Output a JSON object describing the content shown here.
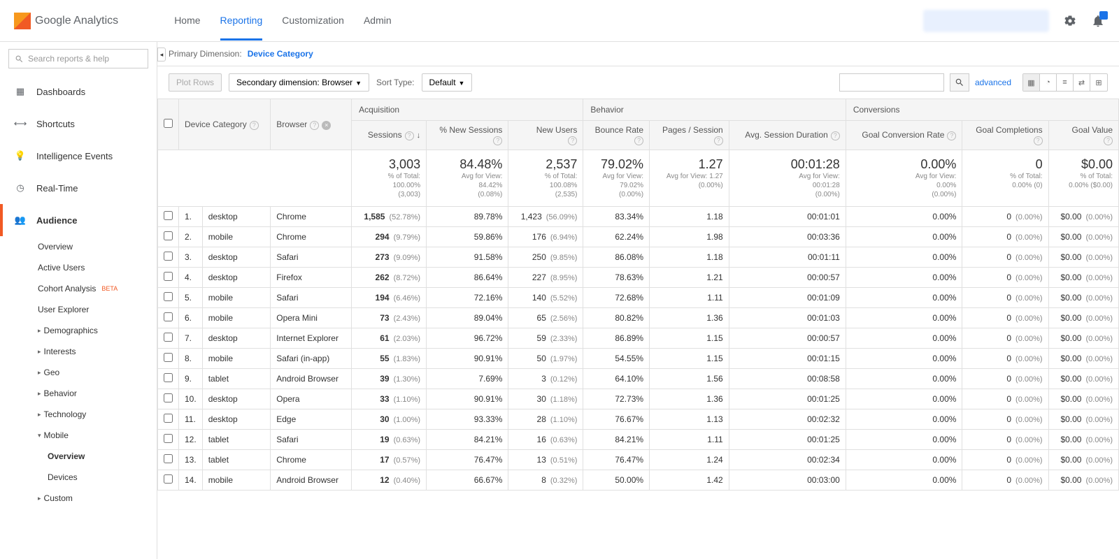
{
  "brand": {
    "name": "Google",
    "product": "Analytics"
  },
  "topnav": [
    {
      "label": "Home",
      "active": false
    },
    {
      "label": "Reporting",
      "active": true
    },
    {
      "label": "Customization",
      "active": false
    },
    {
      "label": "Admin",
      "active": false
    }
  ],
  "search_placeholder": "Search reports & help",
  "sidebar": [
    {
      "icon": "dashboard",
      "label": "Dashboards"
    },
    {
      "icon": "shortcut",
      "label": "Shortcuts"
    },
    {
      "icon": "bulb",
      "label": "Intelligence Events"
    },
    {
      "icon": "clock",
      "label": "Real-Time"
    },
    {
      "icon": "audience",
      "label": "Audience",
      "active": true,
      "children": [
        {
          "label": "Overview"
        },
        {
          "label": "Active Users"
        },
        {
          "label": "Cohort Analysis",
          "beta": "BETA"
        },
        {
          "label": "User Explorer"
        },
        {
          "label": "Demographics",
          "caret": "right"
        },
        {
          "label": "Interests",
          "caret": "right"
        },
        {
          "label": "Geo",
          "caret": "right"
        },
        {
          "label": "Behavior",
          "caret": "right"
        },
        {
          "label": "Technology",
          "caret": "right"
        },
        {
          "label": "Mobile",
          "caret": "down",
          "children": [
            {
              "label": "Overview",
              "bold": true
            },
            {
              "label": "Devices"
            }
          ]
        },
        {
          "label": "Custom",
          "caret": "right"
        }
      ]
    }
  ],
  "primary_dim_label": "Primary Dimension:",
  "primary_dim_value": "Device Category",
  "plot_rows": "Plot Rows",
  "secondary_dim": "Secondary dimension: Browser",
  "sort_type_label": "Sort Type:",
  "sort_type_value": "Default",
  "advanced": "advanced",
  "groups": {
    "acq": "Acquisition",
    "beh": "Behavior",
    "conv": "Conversions"
  },
  "headers": {
    "device": "Device Category",
    "browser": "Browser",
    "sessions": "Sessions",
    "pct_new": "% New Sessions",
    "new_users": "New Users",
    "bounce": "Bounce Rate",
    "pps": "Pages / Session",
    "avg_dur": "Avg. Session Duration",
    "gcr": "Goal Conversion Rate",
    "gc": "Goal Completions",
    "gv": "Goal Value"
  },
  "summary": {
    "sessions": {
      "big": "3,003",
      "l1": "% of Total:",
      "l2": "100.00%",
      "l3": "(3,003)"
    },
    "pct_new": {
      "big": "84.48%",
      "l1": "Avg for View:",
      "l2": "84.42%",
      "l3": "(0.08%)"
    },
    "new_users": {
      "big": "2,537",
      "l1": "% of Total:",
      "l2": "100.08%",
      "l3": "(2,535)"
    },
    "bounce": {
      "big": "79.02%",
      "l1": "Avg for View:",
      "l2": "79.02%",
      "l3": "(0.00%)"
    },
    "pps": {
      "big": "1.27",
      "l1": "Avg for View: 1.27",
      "l2": "(0.00%)"
    },
    "avg_dur": {
      "big": "00:01:28",
      "l1": "Avg for View:",
      "l2": "00:01:28",
      "l3": "(0.00%)"
    },
    "gcr": {
      "big": "0.00%",
      "l1": "Avg for View:",
      "l2": "0.00%",
      "l3": "(0.00%)"
    },
    "gc": {
      "big": "0",
      "l1": "% of Total:",
      "l2": "0.00% (0)"
    },
    "gv": {
      "big": "$0.00",
      "l1": "% of Total:",
      "l2": "0.00% ($0.00)"
    }
  },
  "rows": [
    {
      "i": "1.",
      "device": "desktop",
      "browser": "Chrome",
      "sessions": "1,585",
      "sessions_pct": "(52.78%)",
      "pct_new": "89.78%",
      "new_users": "1,423",
      "new_users_pct": "(56.09%)",
      "bounce": "83.34%",
      "pps": "1.18",
      "dur": "00:01:01",
      "gcr": "0.00%",
      "gc": "0",
      "gc_pct": "(0.00%)",
      "gv": "$0.00",
      "gv_pct": "(0.00%)"
    },
    {
      "i": "2.",
      "device": "mobile",
      "browser": "Chrome",
      "sessions": "294",
      "sessions_pct": "(9.79%)",
      "pct_new": "59.86%",
      "new_users": "176",
      "new_users_pct": "(6.94%)",
      "bounce": "62.24%",
      "pps": "1.98",
      "dur": "00:03:36",
      "gcr": "0.00%",
      "gc": "0",
      "gc_pct": "(0.00%)",
      "gv": "$0.00",
      "gv_pct": "(0.00%)"
    },
    {
      "i": "3.",
      "device": "desktop",
      "browser": "Safari",
      "sessions": "273",
      "sessions_pct": "(9.09%)",
      "pct_new": "91.58%",
      "new_users": "250",
      "new_users_pct": "(9.85%)",
      "bounce": "86.08%",
      "pps": "1.18",
      "dur": "00:01:11",
      "gcr": "0.00%",
      "gc": "0",
      "gc_pct": "(0.00%)",
      "gv": "$0.00",
      "gv_pct": "(0.00%)"
    },
    {
      "i": "4.",
      "device": "desktop",
      "browser": "Firefox",
      "sessions": "262",
      "sessions_pct": "(8.72%)",
      "pct_new": "86.64%",
      "new_users": "227",
      "new_users_pct": "(8.95%)",
      "bounce": "78.63%",
      "pps": "1.21",
      "dur": "00:00:57",
      "gcr": "0.00%",
      "gc": "0",
      "gc_pct": "(0.00%)",
      "gv": "$0.00",
      "gv_pct": "(0.00%)"
    },
    {
      "i": "5.",
      "device": "mobile",
      "browser": "Safari",
      "sessions": "194",
      "sessions_pct": "(6.46%)",
      "pct_new": "72.16%",
      "new_users": "140",
      "new_users_pct": "(5.52%)",
      "bounce": "72.68%",
      "pps": "1.11",
      "dur": "00:01:09",
      "gcr": "0.00%",
      "gc": "0",
      "gc_pct": "(0.00%)",
      "gv": "$0.00",
      "gv_pct": "(0.00%)"
    },
    {
      "i": "6.",
      "device": "mobile",
      "browser": "Opera Mini",
      "sessions": "73",
      "sessions_pct": "(2.43%)",
      "pct_new": "89.04%",
      "new_users": "65",
      "new_users_pct": "(2.56%)",
      "bounce": "80.82%",
      "pps": "1.36",
      "dur": "00:01:03",
      "gcr": "0.00%",
      "gc": "0",
      "gc_pct": "(0.00%)",
      "gv": "$0.00",
      "gv_pct": "(0.00%)"
    },
    {
      "i": "7.",
      "device": "desktop",
      "browser": "Internet Explorer",
      "sessions": "61",
      "sessions_pct": "(2.03%)",
      "pct_new": "96.72%",
      "new_users": "59",
      "new_users_pct": "(2.33%)",
      "bounce": "86.89%",
      "pps": "1.15",
      "dur": "00:00:57",
      "gcr": "0.00%",
      "gc": "0",
      "gc_pct": "(0.00%)",
      "gv": "$0.00",
      "gv_pct": "(0.00%)"
    },
    {
      "i": "8.",
      "device": "mobile",
      "browser": "Safari (in-app)",
      "sessions": "55",
      "sessions_pct": "(1.83%)",
      "pct_new": "90.91%",
      "new_users": "50",
      "new_users_pct": "(1.97%)",
      "bounce": "54.55%",
      "pps": "1.15",
      "dur": "00:01:15",
      "gcr": "0.00%",
      "gc": "0",
      "gc_pct": "(0.00%)",
      "gv": "$0.00",
      "gv_pct": "(0.00%)"
    },
    {
      "i": "9.",
      "device": "tablet",
      "browser": "Android Browser",
      "sessions": "39",
      "sessions_pct": "(1.30%)",
      "pct_new": "7.69%",
      "new_users": "3",
      "new_users_pct": "(0.12%)",
      "bounce": "64.10%",
      "pps": "1.56",
      "dur": "00:08:58",
      "gcr": "0.00%",
      "gc": "0",
      "gc_pct": "(0.00%)",
      "gv": "$0.00",
      "gv_pct": "(0.00%)"
    },
    {
      "i": "10.",
      "device": "desktop",
      "browser": "Opera",
      "sessions": "33",
      "sessions_pct": "(1.10%)",
      "pct_new": "90.91%",
      "new_users": "30",
      "new_users_pct": "(1.18%)",
      "bounce": "72.73%",
      "pps": "1.36",
      "dur": "00:01:25",
      "gcr": "0.00%",
      "gc": "0",
      "gc_pct": "(0.00%)",
      "gv": "$0.00",
      "gv_pct": "(0.00%)"
    },
    {
      "i": "11.",
      "device": "desktop",
      "browser": "Edge",
      "sessions": "30",
      "sessions_pct": "(1.00%)",
      "pct_new": "93.33%",
      "new_users": "28",
      "new_users_pct": "(1.10%)",
      "bounce": "76.67%",
      "pps": "1.13",
      "dur": "00:02:32",
      "gcr": "0.00%",
      "gc": "0",
      "gc_pct": "(0.00%)",
      "gv": "$0.00",
      "gv_pct": "(0.00%)"
    },
    {
      "i": "12.",
      "device": "tablet",
      "browser": "Safari",
      "sessions": "19",
      "sessions_pct": "(0.63%)",
      "pct_new": "84.21%",
      "new_users": "16",
      "new_users_pct": "(0.63%)",
      "bounce": "84.21%",
      "pps": "1.11",
      "dur": "00:01:25",
      "gcr": "0.00%",
      "gc": "0",
      "gc_pct": "(0.00%)",
      "gv": "$0.00",
      "gv_pct": "(0.00%)"
    },
    {
      "i": "13.",
      "device": "tablet",
      "browser": "Chrome",
      "sessions": "17",
      "sessions_pct": "(0.57%)",
      "pct_new": "76.47%",
      "new_users": "13",
      "new_users_pct": "(0.51%)",
      "bounce": "76.47%",
      "pps": "1.24",
      "dur": "00:02:34",
      "gcr": "0.00%",
      "gc": "0",
      "gc_pct": "(0.00%)",
      "gv": "$0.00",
      "gv_pct": "(0.00%)"
    },
    {
      "i": "14.",
      "device": "mobile",
      "browser": "Android Browser",
      "sessions": "12",
      "sessions_pct": "(0.40%)",
      "pct_new": "66.67%",
      "new_users": "8",
      "new_users_pct": "(0.32%)",
      "bounce": "50.00%",
      "pps": "1.42",
      "dur": "00:03:00",
      "gcr": "0.00%",
      "gc": "0",
      "gc_pct": "(0.00%)",
      "gv": "$0.00",
      "gv_pct": "(0.00%)"
    }
  ]
}
